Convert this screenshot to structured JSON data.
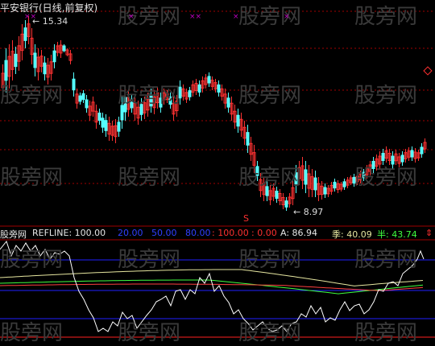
{
  "chart_title": "平安银行(日线,前复权)",
  "price_labels": {
    "high": "15.34",
    "low": "8.97"
  },
  "markers": {
    "top_marks": [
      "××",
      "×",
      "××",
      "×",
      "×"
    ],
    "s_mark": "S"
  },
  "indicator": {
    "name": "股旁网",
    "refline_label": "REFLINE: 100.00",
    "levels": [
      {
        "text": "20.00",
        "color": "#3040ff"
      },
      {
        "text": "50.00",
        "color": "#3040ff"
      },
      {
        "text": "80.00",
        "color": "#3040ff"
      },
      {
        "text": ": 100.00",
        "color": "#ff3030"
      },
      {
        "text": ": 0.00",
        "color": "#ff3030"
      }
    ],
    "a_label": "A: 86.94",
    "ji_label": "季: 40.09",
    "ban_label": "半: 43.74",
    "arrow": "⇕"
  },
  "watermark": "股旁网",
  "colors": {
    "up": "#ff3232",
    "down": "#54ffff",
    "grid": "#a00000",
    "line_white": "#ffffff",
    "line_red": "#ff4040",
    "line_green": "#40ff40",
    "line_yellow": "#e6e6a0",
    "hline_blue": "#2020ff"
  },
  "chart_data": {
    "type": "candlestick",
    "price_range": [
      8.5,
      15.8
    ],
    "high": 15.34,
    "low": 8.97,
    "indicator_lines": [
      "A",
      "季",
      "半"
    ],
    "indicator_values": {
      "A": 86.94,
      "季": 40.09,
      "半": 43.74
    },
    "reference_levels": [
      0,
      20,
      50,
      80,
      100
    ]
  }
}
